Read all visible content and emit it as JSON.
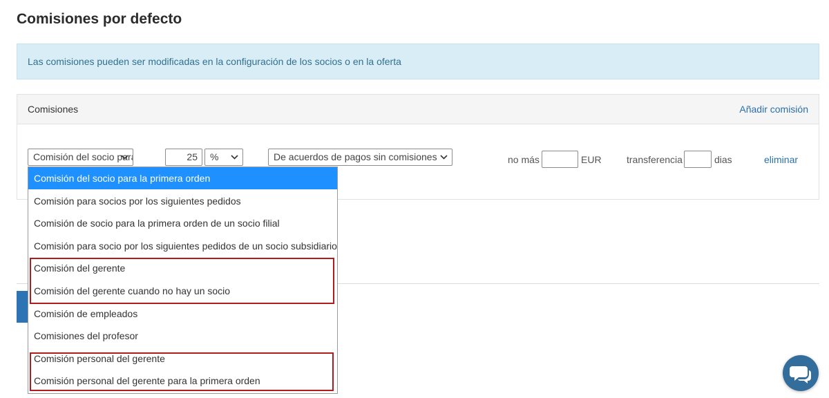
{
  "page": {
    "title": "Comisiones por defecto"
  },
  "alert": {
    "text": "Las comisiones pueden ser modificadas en la configuración de los socios o en la oferta"
  },
  "panel": {
    "title": "Comisiones",
    "add_label": "Añadir comisión"
  },
  "row": {
    "type_value": "Comisión del socio para la primera orden",
    "amount": "25",
    "unit_value": "%",
    "source_value": "De acuerdos de pagos sin comisiones",
    "max_label": "no más",
    "max_value": "",
    "currency": "EUR",
    "transfer_label": "transferencia",
    "transfer_value": "",
    "days_label": "dias",
    "delete_label": "eliminar"
  },
  "dropdown": {
    "options": [
      "Comisión del socio para la primera orden",
      "Comisión para socios por los siguientes pedidos",
      "Comisión de socio para la primera orden de un socio filial",
      "Comisión para socio por los siguientes pedidos de un socio subsidiario",
      "Comisión del gerente",
      "Comisión del gerente cuando no hay un socio",
      "Comisión de empleados",
      "Comisiones del profesor",
      "Comisión personal del gerente",
      "Comisión personal del gerente para la primera orden"
    ],
    "selected_index": 0
  },
  "colors": {
    "accent": "#2a6fad",
    "selected_option": "#1e90ff",
    "highlight_border": "#b01c1c",
    "alert_bg": "#d9edf7"
  },
  "icons": {
    "select_arrow": "chevron-down-icon",
    "chat": "chat-bubbles-icon"
  }
}
